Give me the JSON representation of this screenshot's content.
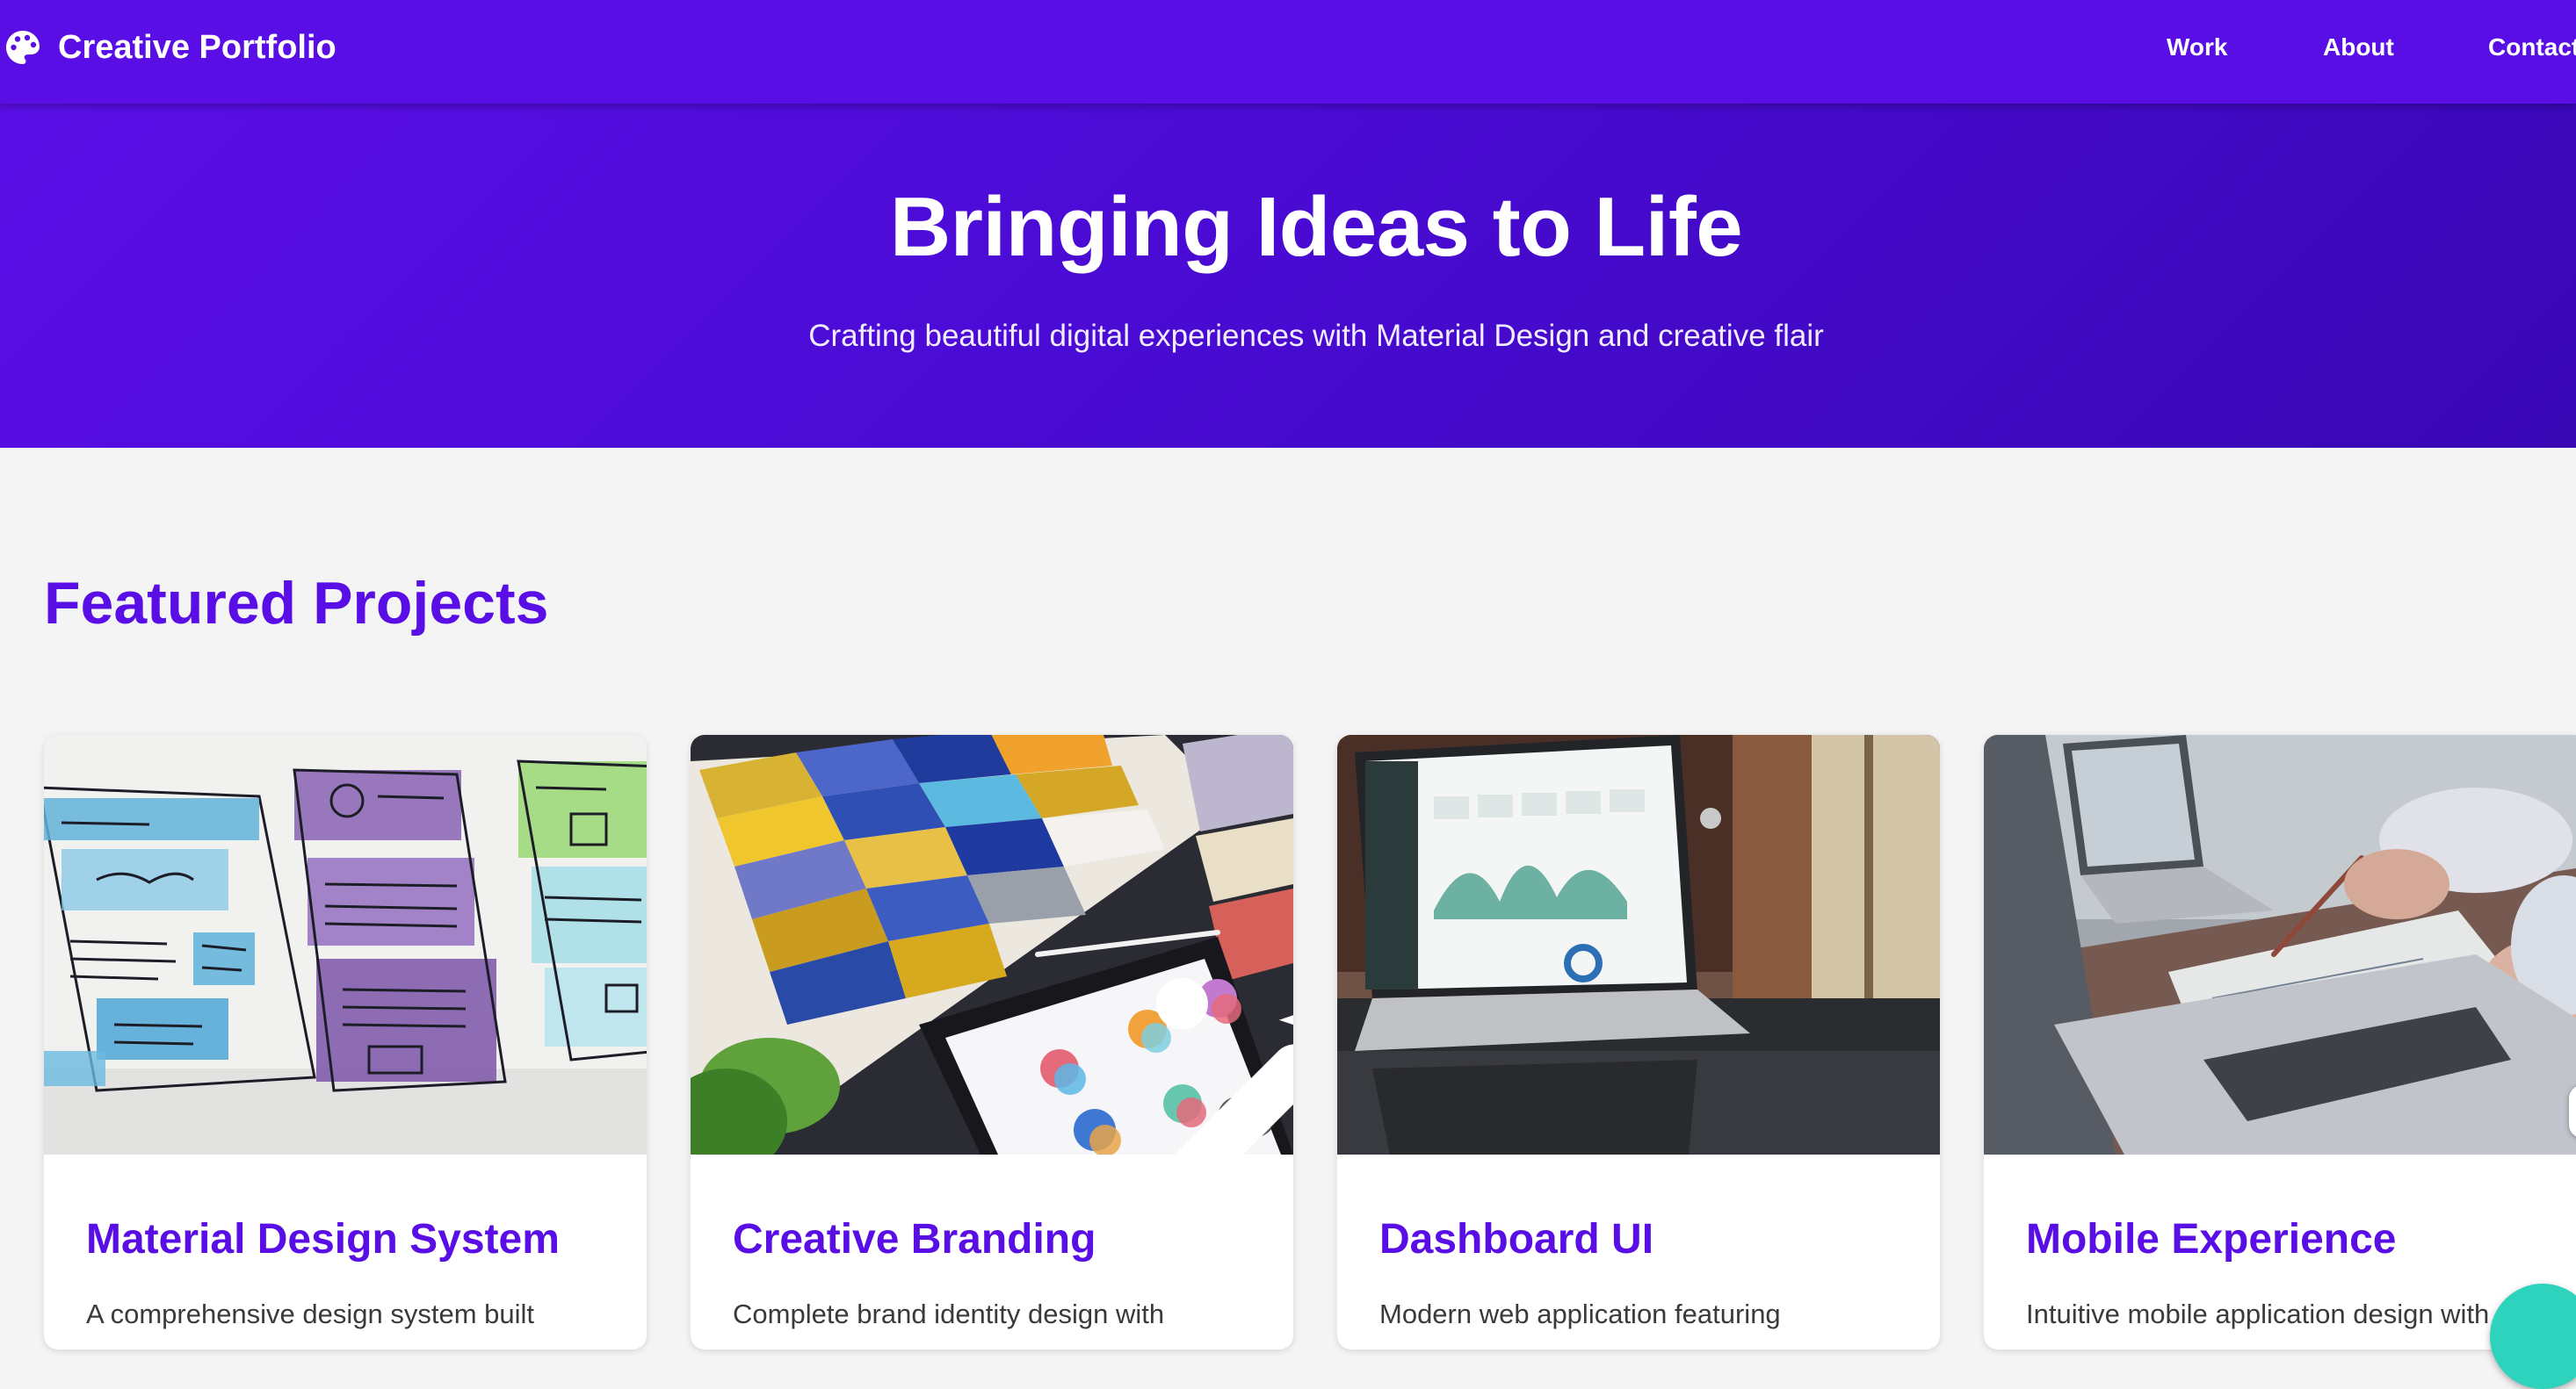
{
  "header": {
    "brand_icon": "palette-icon",
    "title": "Creative Portfolio",
    "nav": [
      {
        "label": "Work"
      },
      {
        "label": "About"
      },
      {
        "label": "Contact"
      }
    ]
  },
  "hero": {
    "title": "Bringing Ideas to Life",
    "subtitle": "Crafting beautiful digital experiences with Material Design and creative flair"
  },
  "projects": {
    "title": "Featured Projects",
    "cards": [
      {
        "title": "Material Design System",
        "description": "A comprehensive design system built",
        "image": "wireframe-sketches"
      },
      {
        "title": "Creative Branding",
        "description": "Complete brand identity design with",
        "image": "color-swatches-and-tablet"
      },
      {
        "title": "Dashboard UI",
        "description": "Modern web application featuring",
        "image": "laptop-analytics-dashboard"
      },
      {
        "title": "Mobile Experience",
        "description": "Intuitive mobile application design with",
        "image": "hands-writing-near-laptop"
      }
    ]
  },
  "colors": {
    "primary": "#5a0ee6",
    "hero_dark": "#3807b4",
    "background": "#f4f4f4",
    "fab": "#2ed3bd"
  }
}
